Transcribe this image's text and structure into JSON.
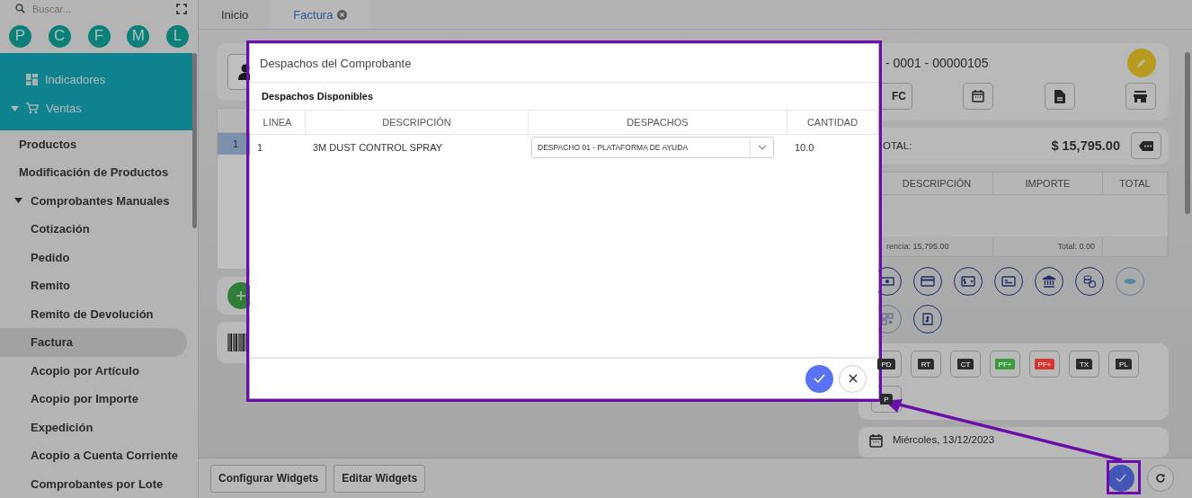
{
  "sidebar": {
    "search": {
      "placeholder": "Buscar..."
    },
    "shortcuts": [
      {
        "label": "P"
      },
      {
        "label": "C"
      },
      {
        "label": "F"
      },
      {
        "label": "M"
      },
      {
        "label": "L"
      }
    ],
    "nav": [
      {
        "label": "Indicadores",
        "kind": "dashboard"
      },
      {
        "label": "Ventas",
        "kind": "cart",
        "expanded": true,
        "children": [
          {
            "label": "Productos",
            "selected": false
          },
          {
            "label": "Modificación de Productos",
            "selected": false
          },
          {
            "label": "Comprobantes Manuales",
            "expanded": true,
            "children": [
              {
                "label": "Cotización",
                "selected": false
              },
              {
                "label": "Pedido",
                "selected": false
              },
              {
                "label": "Remito",
                "selected": false
              },
              {
                "label": "Remito de Devolución",
                "selected": false
              },
              {
                "label": "Factura",
                "selected": true
              },
              {
                "label": "Acopio por Artículo",
                "selected": false
              },
              {
                "label": "Acopio por Importe",
                "selected": false
              },
              {
                "label": "Expedición",
                "selected": false
              },
              {
                "label": "Acopio a Cuenta Corriente",
                "selected": false
              },
              {
                "label": "Comprobantes por Lote",
                "selected": false
              }
            ]
          }
        ]
      }
    ]
  },
  "tabs": [
    {
      "label": "Inicio",
      "selected": false,
      "closable": false
    },
    {
      "label": "Factura",
      "selected": true,
      "closable": true
    }
  ],
  "items_table": {
    "rows": [
      {
        "line": "1",
        "selected": true
      }
    ]
  },
  "voucher": {
    "number": "- 0001 - 00000105",
    "type_button": "FC"
  },
  "totals": {
    "label": "OTAL:",
    "amount": "$ 15,795.00"
  },
  "payments_table": {
    "columns": [
      "DESCRIPCIÓN",
      "IMPORTE",
      "TOTAL"
    ],
    "footer": [
      "rencia: 15,795.00",
      "Total: 0.00"
    ]
  },
  "documents": [
    {
      "label": "PD",
      "color": "#2b2b2b"
    },
    {
      "label": "RT",
      "color": "#2b2b2b"
    },
    {
      "label": "CT",
      "color": "#2b2b2b"
    },
    {
      "label": "PF+",
      "color": "#3b9a3b"
    },
    {
      "label": "PF+",
      "color": "#d9342f"
    },
    {
      "label": "TX",
      "color": "#2b2b2b"
    },
    {
      "label": "PL",
      "color": "#2b2b2b"
    },
    {
      "label": "P",
      "color": "#2b2b2b"
    }
  ],
  "date": "Miércoles, 13/12/2023",
  "bottom_buttons": [
    "Configurar Widgets",
    "Editar Widgets"
  ],
  "modal": {
    "title": "Despachos del Comprobante",
    "section": "Despachos Disponibles",
    "columns": [
      "LINEA",
      "DESCRIPCIÓN",
      "DESPACHOS",
      "CANTIDAD"
    ],
    "rows": [
      {
        "line": "1",
        "description": "3M DUST CONTROL SPRAY",
        "dispatch": "DESPACHO 01 - PLATAFORMA DE AYUDA",
        "quantity": "10.0"
      }
    ]
  }
}
